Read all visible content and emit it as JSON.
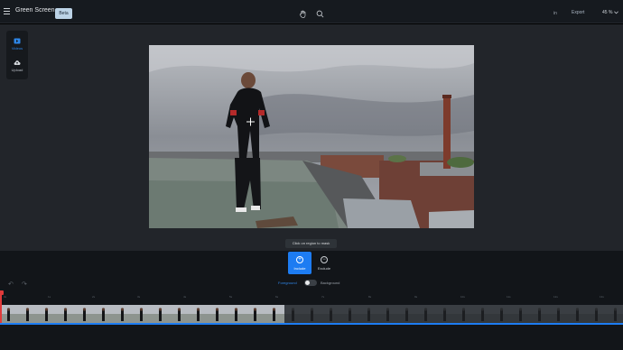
{
  "header": {
    "title": "Green Screen",
    "badge": "Beta",
    "in_label": "in",
    "export_label": "Export",
    "zoom_value": "45 %",
    "icons": [
      "menu-icon",
      "hand-icon",
      "search-icon",
      "chevron-down-icon"
    ]
  },
  "sidebar": {
    "items": [
      {
        "label": "Videos",
        "icon": "video-icon",
        "active": true
      },
      {
        "label": "Upload",
        "icon": "cloud-upload-icon",
        "active": false
      }
    ]
  },
  "canvas": {
    "tooltip": "Click on region to mask"
  },
  "mask_tools": {
    "include_label": "Include",
    "exclude_label": "Exclude",
    "foreground_label": "Foreground",
    "background_label": "Background",
    "toggle_state": "foreground"
  },
  "timeline": {
    "ticks": [
      "0s",
      "1s",
      "2s",
      "3s",
      "4s",
      "5s",
      "6s",
      "7s",
      "8s",
      "9s",
      "10s",
      "11s",
      "12s",
      "13s"
    ],
    "processed_fraction": 0.45
  },
  "colors": {
    "accent": "#1d7cf2",
    "playhead": "#e03a3a",
    "topbar": "#161a1f",
    "workspace": "#22252a"
  }
}
